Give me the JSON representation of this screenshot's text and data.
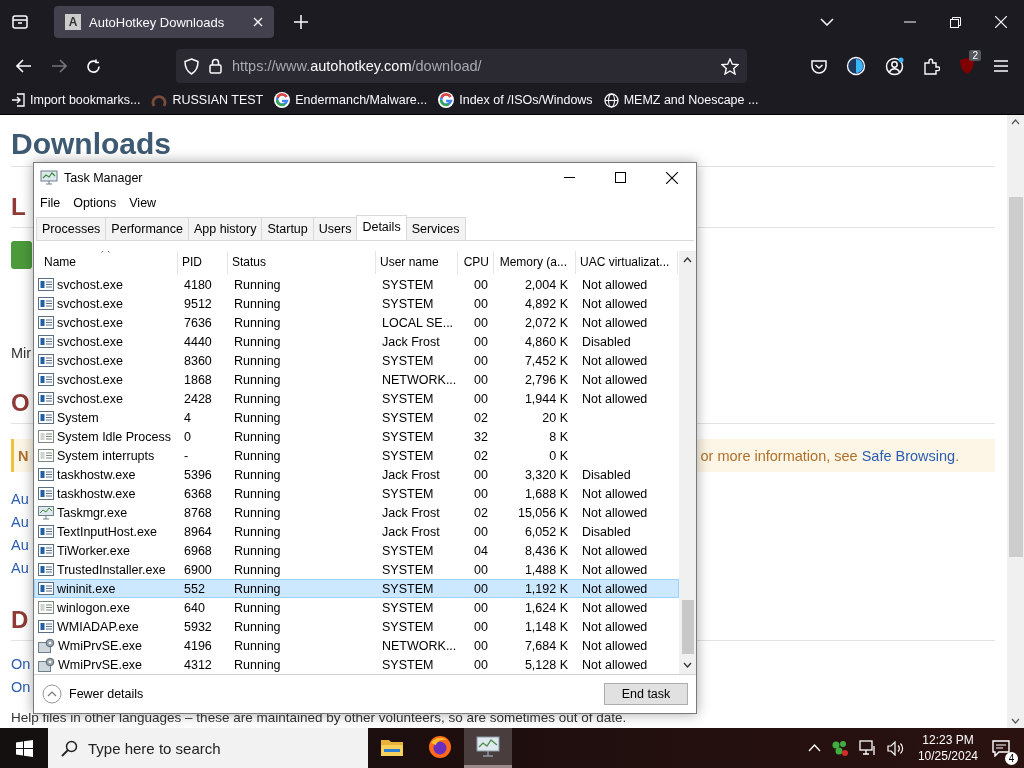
{
  "browser": {
    "tabs": [
      {
        "title": "AutoHotkey Downloads",
        "icon_letter": "A",
        "selected": true
      }
    ],
    "url": {
      "scheme": "https://www.",
      "host": "autohotkey.com",
      "path": "/download/"
    },
    "extension_badge": "2",
    "bookmarks": [
      {
        "kind": "import",
        "label": "Import bookmarks..."
      },
      {
        "kind": "ring",
        "label": "RUSSIAN TEST"
      },
      {
        "kind": "g",
        "label": "Endermanch/Malware..."
      },
      {
        "kind": "g",
        "label": "Index of /ISOs/Windows"
      },
      {
        "kind": "globe",
        "label": "MEMZ and Noescape ..."
      }
    ]
  },
  "page": {
    "heading": "Downloads",
    "items": [
      {
        "kind": "h2",
        "text": "L"
      },
      {
        "kind": "button"
      },
      {
        "kind": "text",
        "text": "Mir"
      },
      {
        "kind": "h2",
        "text": "O"
      },
      {
        "kind": "notice",
        "lead": "N",
        "text": "or more information, see ",
        "link": "Safe Browsing",
        "tail": "."
      },
      {
        "kind": "link",
        "text": "Au"
      },
      {
        "kind": "link",
        "text": "Au"
      },
      {
        "kind": "link",
        "text": "Au"
      },
      {
        "kind": "link",
        "text": "Au"
      },
      {
        "kind": "h2",
        "text": "D"
      },
      {
        "kind": "link",
        "text": "On"
      },
      {
        "kind": "link",
        "text": "On"
      },
      {
        "kind": "text",
        "text": "Help files in other languages – these are maintained by other volunteers, so are sometimes out of date."
      }
    ]
  },
  "task_manager": {
    "title": "Task Manager",
    "menu": [
      "File",
      "Options",
      "View"
    ],
    "tabs": [
      {
        "label": "Processes",
        "selected": false
      },
      {
        "label": "Performance",
        "selected": false
      },
      {
        "label": "App history",
        "selected": false
      },
      {
        "label": "Startup",
        "selected": false
      },
      {
        "label": "Users",
        "selected": false
      },
      {
        "label": "Details",
        "selected": true
      },
      {
        "label": "Services",
        "selected": false
      }
    ],
    "columns": [
      "Name",
      "PID",
      "Status",
      "User name",
      "CPU",
      "Memory (a...",
      "UAC virtualizat..."
    ],
    "rows": [
      {
        "kind": "app",
        "name": "svchost.exe",
        "pid": "4180",
        "status": "Running",
        "user": "SYSTEM",
        "cpu": "00",
        "memory": "2,004 K",
        "uac": "Not allowed",
        "selected": false
      },
      {
        "kind": "app",
        "name": "svchost.exe",
        "pid": "9512",
        "status": "Running",
        "user": "SYSTEM",
        "cpu": "00",
        "memory": "4,892 K",
        "uac": "Not allowed",
        "selected": false
      },
      {
        "kind": "app",
        "name": "svchost.exe",
        "pid": "7636",
        "status": "Running",
        "user": "LOCAL SE...",
        "cpu": "00",
        "memory": "2,072 K",
        "uac": "Not allowed",
        "selected": false
      },
      {
        "kind": "app",
        "name": "svchost.exe",
        "pid": "4440",
        "status": "Running",
        "user": "Jack Frost",
        "cpu": "00",
        "memory": "4,860 K",
        "uac": "Disabled",
        "selected": false
      },
      {
        "kind": "app",
        "name": "svchost.exe",
        "pid": "8360",
        "status": "Running",
        "user": "SYSTEM",
        "cpu": "00",
        "memory": "7,452 K",
        "uac": "Not allowed",
        "selected": false
      },
      {
        "kind": "app",
        "name": "svchost.exe",
        "pid": "1868",
        "status": "Running",
        "user": "NETWORK...",
        "cpu": "00",
        "memory": "2,796 K",
        "uac": "Not allowed",
        "selected": false
      },
      {
        "kind": "app",
        "name": "svchost.exe",
        "pid": "2428",
        "status": "Running",
        "user": "SYSTEM",
        "cpu": "00",
        "memory": "1,944 K",
        "uac": "Not allowed",
        "selected": false
      },
      {
        "kind": "app",
        "name": "System",
        "pid": "4",
        "status": "Running",
        "user": "SYSTEM",
        "cpu": "02",
        "memory": "20 K",
        "selected": false
      },
      {
        "kind": "plain",
        "name": "System Idle Process",
        "pid": "0",
        "status": "Running",
        "user": "SYSTEM",
        "cpu": "32",
        "memory": "8 K",
        "selected": false
      },
      {
        "kind": "plain",
        "name": "System interrupts",
        "pid": "-",
        "status": "Running",
        "user": "SYSTEM",
        "cpu": "02",
        "memory": "0 K",
        "selected": false
      },
      {
        "kind": "app",
        "name": "taskhostw.exe",
        "pid": "5396",
        "status": "Running",
        "user": "Jack Frost",
        "cpu": "00",
        "memory": "3,320 K",
        "uac": "Disabled",
        "selected": false
      },
      {
        "kind": "app",
        "name": "taskhostw.exe",
        "pid": "6368",
        "status": "Running",
        "user": "SYSTEM",
        "cpu": "00",
        "memory": "1,688 K",
        "uac": "Not allowed",
        "selected": false
      },
      {
        "kind": "monitor",
        "name": "Taskmgr.exe",
        "pid": "8768",
        "status": "Running",
        "user": "Jack Frost",
        "cpu": "02",
        "memory": "15,056 K",
        "uac": "Not allowed",
        "selected": false
      },
      {
        "kind": "app",
        "name": "TextInputHost.exe",
        "pid": "8964",
        "status": "Running",
        "user": "Jack Frost",
        "cpu": "00",
        "memory": "6,052 K",
        "uac": "Disabled",
        "selected": false
      },
      {
        "kind": "app",
        "name": "TiWorker.exe",
        "pid": "6968",
        "status": "Running",
        "user": "SYSTEM",
        "cpu": "04",
        "memory": "8,436 K",
        "uac": "Not allowed",
        "selected": false
      },
      {
        "kind": "app",
        "name": "TrustedInstaller.exe",
        "pid": "6900",
        "status": "Running",
        "user": "SYSTEM",
        "cpu": "00",
        "memory": "1,488 K",
        "uac": "Not allowed",
        "selected": false
      },
      {
        "kind": "app",
        "name": "wininit.exe",
        "pid": "552",
        "status": "Running",
        "user": "SYSTEM",
        "cpu": "00",
        "memory": "1,192 K",
        "uac": "Not allowed",
        "selected": true
      },
      {
        "kind": "plain",
        "name": "winlogon.exe",
        "pid": "640",
        "status": "Running",
        "user": "SYSTEM",
        "cpu": "00",
        "memory": "1,624 K",
        "uac": "Not allowed",
        "selected": false
      },
      {
        "kind": "app",
        "name": "WMIADAP.exe",
        "pid": "5932",
        "status": "Running",
        "user": "SYSTEM",
        "cpu": "00",
        "memory": "1,148 K",
        "uac": "Not allowed",
        "selected": false
      },
      {
        "kind": "gears",
        "name": "WmiPrvSE.exe",
        "pid": "4196",
        "status": "Running",
        "user": "NETWORK...",
        "cpu": "00",
        "memory": "7,684 K",
        "uac": "Not allowed",
        "selected": false
      },
      {
        "kind": "gears",
        "name": "WmiPrvSE.exe",
        "pid": "4312",
        "status": "Running",
        "user": "SYSTEM",
        "cpu": "00",
        "memory": "5,128 K",
        "uac": "Not allowed",
        "selected": false
      }
    ],
    "fewer_details": "Fewer details",
    "end_task": "End task"
  },
  "taskbar": {
    "search_placeholder": "Type here to search",
    "apps": [
      {
        "kind": "folder",
        "selected": false
      },
      {
        "kind": "browser",
        "selected": false
      },
      {
        "kind": "monitor",
        "selected": true
      }
    ],
    "time": "12:23 PM",
    "date": "10/25/2024",
    "notifications": "4"
  }
}
